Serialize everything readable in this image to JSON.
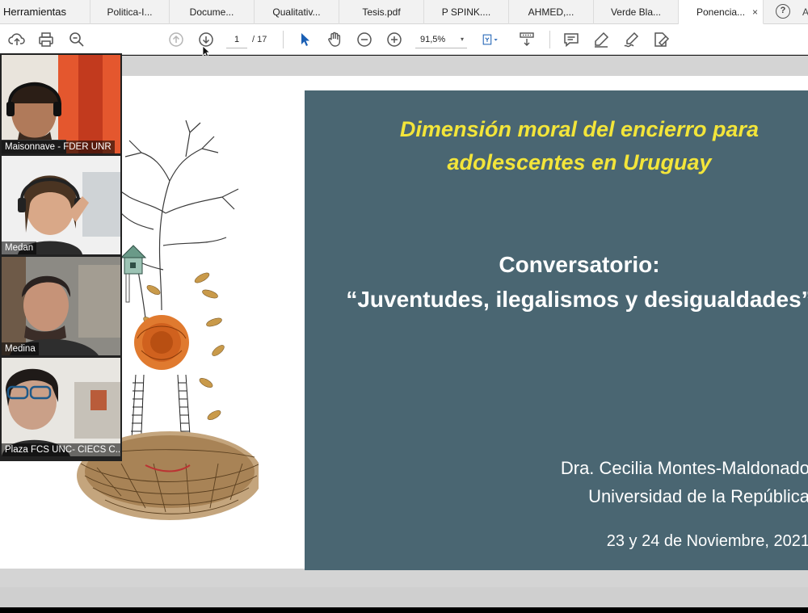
{
  "app": {
    "home_tab": "Herramientas",
    "tabs": [
      {
        "label": "Politica-I..."
      },
      {
        "label": "Docume..."
      },
      {
        "label": "Qualitativ..."
      },
      {
        "label": "Tesis.pdf"
      },
      {
        "label": "P SPINK...."
      },
      {
        "label": "AHMED,..."
      },
      {
        "label": "Verde Bla..."
      },
      {
        "label": "Ponencia..."
      }
    ],
    "active_tab_close": "×",
    "help": "?",
    "overflow": "A"
  },
  "toolbar": {
    "icons": [
      "cloud-upload-icon",
      "print-icon",
      "search-zoom-icon",
      "previous-page-icon",
      "next-page-icon",
      "select-cursor-icon",
      "hand-pan-icon",
      "zoom-out-icon",
      "zoom-in-icon",
      "fit-page-icon",
      "scroll-mode-icon",
      "comment-icon",
      "highlight-pen-icon",
      "draw-icon",
      "sign-icon"
    ],
    "current_page": "1",
    "total_pages": "/ 17",
    "zoom": "91,5%",
    "zoom_caret": "▾"
  },
  "slide": {
    "title_line1": "Dimensión moral del encierro para",
    "title_line2": "adolescentes en Uruguay",
    "subtitle_line1": "Conversatorio:",
    "subtitle_line2": "“Juventudes, ilegalismos y desigualdades”",
    "author_name": "Dra. Cecilia Montes-Maldonado",
    "author_affiliation": "Universidad de la República",
    "date": "23 y 24 de Noviembre, 2021",
    "colors": {
      "background": "#4a6672",
      "title": "#f3e53a",
      "text": "#ffffff"
    }
  },
  "participants": [
    {
      "name": "Maisonnave - FDER UNR"
    },
    {
      "name": "Medan"
    },
    {
      "name": "Medina"
    },
    {
      "name": "Plaza FCS UNC- CIECS C..."
    }
  ]
}
